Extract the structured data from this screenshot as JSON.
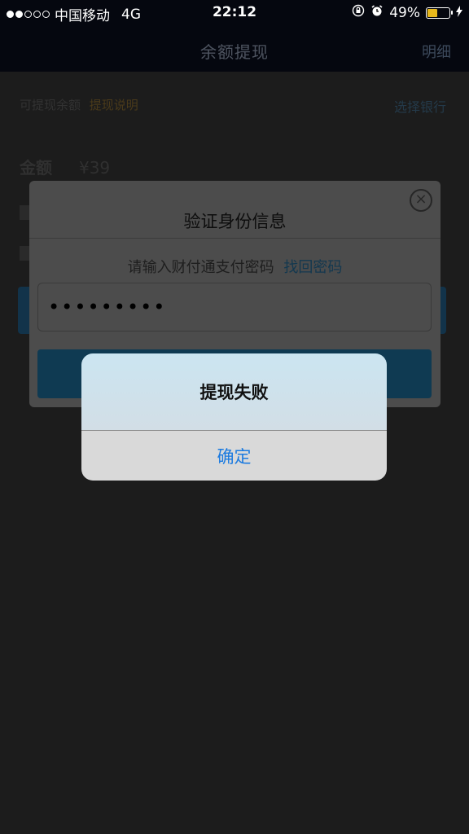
{
  "status_bar": {
    "carrier": "中国移动",
    "network": "4G",
    "time": "22:12",
    "battery": "49%",
    "battery_level": 0.49,
    "signal_bars_filled": 2,
    "signal_bars_total": 5
  },
  "background": {
    "nav_title": "余额提现",
    "nav_action": "明细",
    "row1_left": "可提现余额",
    "row1_warn": "提现说明",
    "row1_right": "选择银行",
    "amount_label": "金额",
    "amount_value": "¥39"
  },
  "verify_dialog": {
    "title": "验证身份信息",
    "prompt": "请输入财付通支付密码",
    "forgot_link": "找回密码",
    "password_masked": "•••••••••"
  },
  "alert": {
    "title": "提现失败",
    "confirm_label": "确定"
  },
  "colors": {
    "accent": "#1a7ae0",
    "battery": "#e7b81c"
  }
}
